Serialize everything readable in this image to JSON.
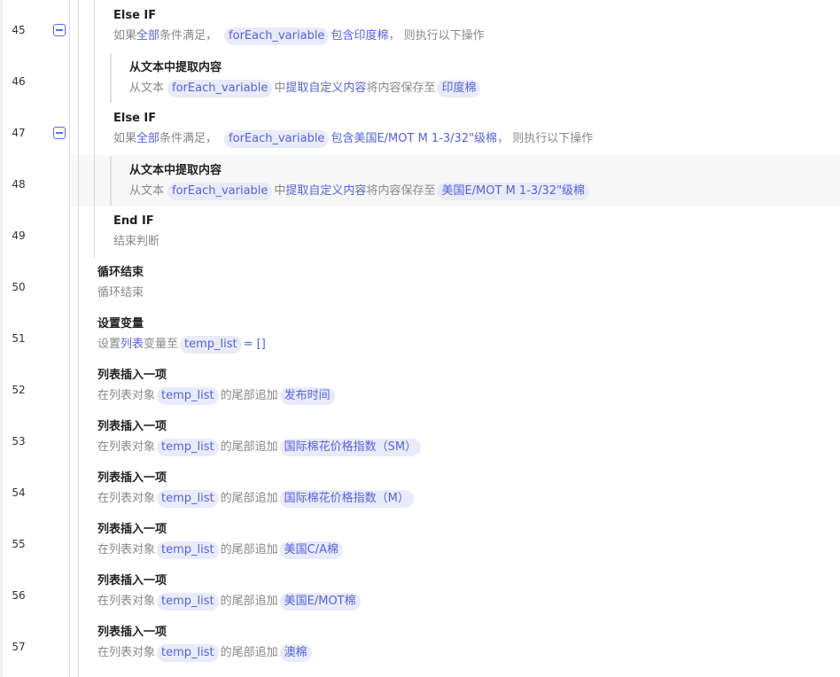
{
  "rows": [
    {
      "line": "45",
      "title": "Else IF",
      "desc": {
        "p1": "如果",
        "kw1": "全部",
        "p2": "条件满足，",
        "var": "forEach_variable",
        "kw2": "包含",
        "val": "印度棉",
        "p3": "，  则执行以下操作"
      }
    },
    {
      "line": "46",
      "title": "从文本中提取内容",
      "desc": {
        "p1": "从文本",
        "var": "forEach_variable",
        "p2": "中",
        "kw1": "提取自定义内容",
        "p3": "将内容保存至",
        "out": "印度棉"
      }
    },
    {
      "line": "47",
      "title": "Else IF",
      "desc": {
        "p1": "如果",
        "kw1": "全部",
        "p2": "条件满足，",
        "var": "forEach_variable",
        "kw2": "包含",
        "val": "美国E/MOT M 1-3/32\"级棉",
        "p3": "，  则执行以下操作"
      }
    },
    {
      "line": "48",
      "title": "从文本中提取内容",
      "desc": {
        "p1": "从文本",
        "var": "forEach_variable",
        "p2": "中",
        "kw1": "提取自定义内容",
        "p3": "将内容保存至",
        "out": "美国E/MOT M 1-3/32\"级棉"
      }
    },
    {
      "line": "49",
      "title": "End IF",
      "desc": {
        "p1": "结束判断"
      }
    },
    {
      "line": "50",
      "title": "循环结束",
      "desc": {
        "p1": "循环结束"
      }
    },
    {
      "line": "51",
      "title": "设置变量",
      "desc": {
        "p1": "设置",
        "kw1": "列表",
        "p2": "变量至",
        "var": "temp_list",
        "p3": "= []"
      }
    },
    {
      "line": "52",
      "title": "列表插入一项",
      "desc": {
        "p1": "在列表对象",
        "var": "temp_list",
        "p2": "的尾部追加",
        "val": "发布时间"
      }
    },
    {
      "line": "53",
      "title": "列表插入一项",
      "desc": {
        "p1": "在列表对象",
        "var": "temp_list",
        "p2": "的尾部追加",
        "val": "国际棉花价格指数（SM）"
      }
    },
    {
      "line": "54",
      "title": "列表插入一项",
      "desc": {
        "p1": "在列表对象",
        "var": "temp_list",
        "p2": "的尾部追加",
        "val": "国际棉花价格指数（M）"
      }
    },
    {
      "line": "55",
      "title": "列表插入一项",
      "desc": {
        "p1": "在列表对象",
        "var": "temp_list",
        "p2": "的尾部追加",
        "val": "美国C/A棉"
      }
    },
    {
      "line": "56",
      "title": "列表插入一项",
      "desc": {
        "p1": "在列表对象",
        "var": "temp_list",
        "p2": "的尾部追加",
        "val": "美国E/MOT棉"
      }
    },
    {
      "line": "57",
      "title": "列表插入一项",
      "desc": {
        "p1": "在列表对象",
        "var": "temp_list",
        "p2": "的尾部追加",
        "val": "澳棉"
      }
    }
  ]
}
